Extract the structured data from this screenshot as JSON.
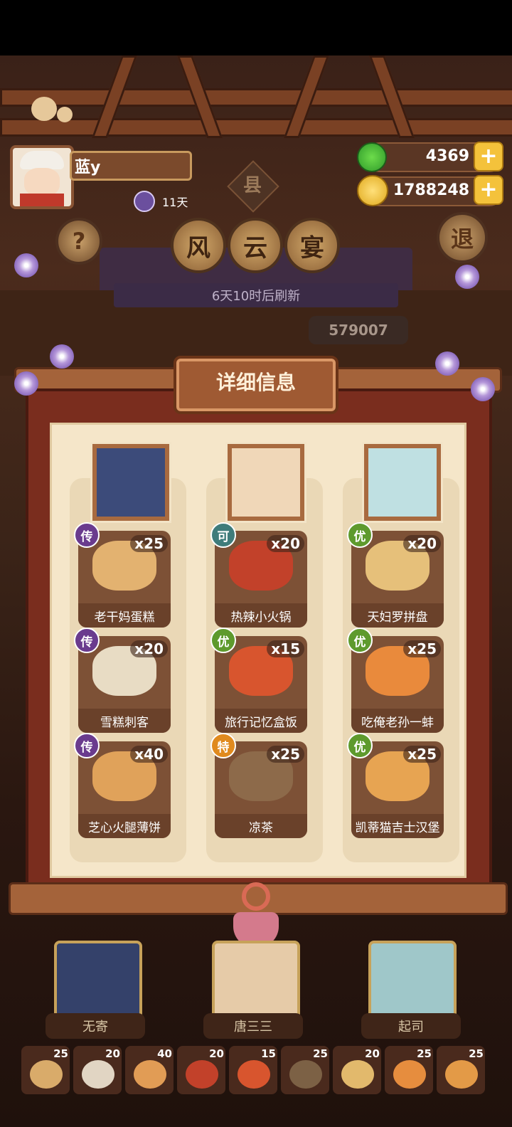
{
  "player": {
    "name": "蓝y",
    "days": "11天"
  },
  "resources": {
    "apples": "4369",
    "coins": "1788248"
  },
  "event": {
    "region_badge": "县",
    "title_chars": [
      "风",
      "云",
      "宴"
    ],
    "refresh_text": "6天10时后刷新",
    "score_partial": "579007"
  },
  "buttons": {
    "help": "?",
    "exit": "退",
    "plus": "+"
  },
  "panel": {
    "title": "详细信息"
  },
  "columns": [
    {
      "chef": "无寄",
      "foods": [
        {
          "name": "老干妈蛋糕",
          "qty": "x25",
          "badge": "传",
          "badge_color": "#6a3b8e",
          "color": "#e3b270"
        },
        {
          "name": "雪糕刺客",
          "qty": "x20",
          "badge": "传",
          "badge_color": "#6a3b8e",
          "color": "#e8dcc4"
        },
        {
          "name": "芝心火腿薄饼",
          "qty": "x40",
          "badge": "传",
          "badge_color": "#6a3b8e",
          "color": "#e0a25a"
        }
      ]
    },
    {
      "chef": "唐三三",
      "foods": [
        {
          "name": "热辣小火锅",
          "qty": "x20",
          "badge": "可",
          "badge_color": "#3f7c7b",
          "color": "#c2412a"
        },
        {
          "name": "旅行记忆盒饭",
          "qty": "x15",
          "badge": "优",
          "badge_color": "#5e9a2d",
          "color": "#d8552e"
        },
        {
          "name": "凉茶",
          "qty": "x25",
          "badge": "特",
          "badge_color": "#e08a1e",
          "color": "#8d6a4a"
        }
      ]
    },
    {
      "chef": "起司",
      "foods": [
        {
          "name": "天妇罗拼盘",
          "qty": "x20",
          "badge": "优",
          "badge_color": "#5e9a2d",
          "color": "#e6c07a"
        },
        {
          "name": "吃俺老孙一蚌",
          "qty": "x25",
          "badge": "优",
          "badge_color": "#5e9a2d",
          "color": "#e98a3c"
        },
        {
          "name": "凯蒂猫吉士汉堡",
          "qty": "x25",
          "badge": "优",
          "badge_color": "#5e9a2d",
          "color": "#e7a452"
        }
      ]
    }
  ],
  "bottom_items": [
    "25",
    "20",
    "40",
    "20",
    "15",
    "25",
    "20",
    "25",
    "25"
  ],
  "bottom_colors": [
    "#d9ab6a",
    "#e1d5c3",
    "#e19c55",
    "#c2412a",
    "#d8552e",
    "#7c6145",
    "#e2b96c",
    "#e68d3e",
    "#e39a47"
  ],
  "colors": {
    "panel_red": "#7a2d1e",
    "parchment": "#f5e6c9",
    "gold": "#f4c23b",
    "apple_green": "#2f9a2a"
  }
}
